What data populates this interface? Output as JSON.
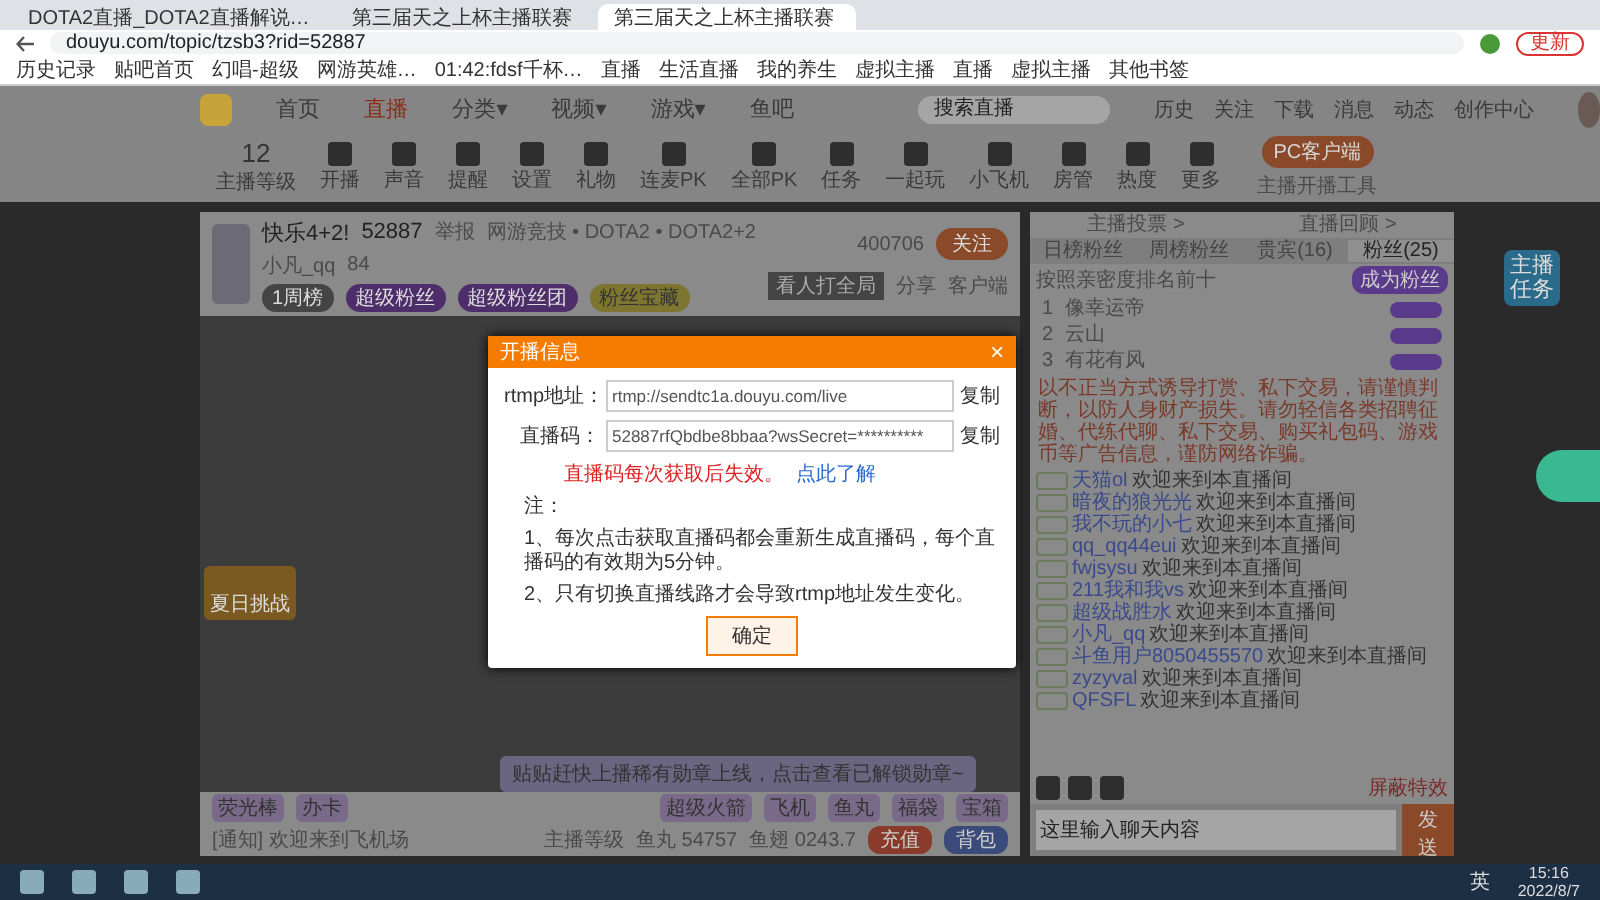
{
  "browser": {
    "tabs": [
      {
        "title": "DOTA2直播_DOTA2直播解说…",
        "selected": false
      },
      {
        "title": "第三届天之上杯主播联赛",
        "selected": false
      },
      {
        "title": "第三届天之上杯主播联赛",
        "selected": true
      }
    ],
    "address": "douyu.com/topic/tzsb3?rid=52887",
    "update_button": "更新",
    "bookmarks": [
      "历史记录",
      "贴吧首页",
      "幻唱-超级",
      "网游英雄…",
      "01:42:fdsf千杯…",
      "直播",
      "生活直播",
      "我的养生",
      "虚拟主播",
      "直播",
      "虚拟主播",
      "其他书签"
    ]
  },
  "nav": {
    "items": [
      {
        "label": "首页",
        "selected": false
      },
      {
        "label": "直播",
        "selected": true
      },
      {
        "label": "分类▾",
        "selected": false
      },
      {
        "label": "视频▾",
        "selected": false
      },
      {
        "label": "游戏▾",
        "selected": false
      },
      {
        "label": "鱼吧",
        "selected": false
      }
    ],
    "search": {
      "placeholder": "搜索直播"
    },
    "actions": [
      "历史",
      "关注",
      "下载",
      "消息",
      "动态",
      "创作中心"
    ]
  },
  "toolbar": {
    "level": "12",
    "level_label": "主播等级",
    "items": [
      "开播",
      "声音",
      "提醒",
      "设置",
      "礼物",
      "连麦PK",
      "全部PK",
      "任务",
      "一起玩",
      "小飞机",
      "房管",
      "热度",
      "更多"
    ],
    "pc_button": "PC客户端",
    "pc_caption": "主播开播工具"
  },
  "room": {
    "title": "快乐4+2!",
    "room_id": "52887",
    "report": "举报",
    "category": "网游竞技 • DOTA2 • DOTA2+2",
    "streamer": "小凡_qq",
    "heat": "84",
    "follow_count": "400706",
    "follow_button": "关注",
    "share": "分享",
    "client": "客户端",
    "rank_badge": "看人打全局",
    "tags": [
      "1周榜",
      "超级粉丝",
      "超级粉丝团",
      "粉丝宝藏"
    ],
    "side_badge": "夏日挑战"
  },
  "banner": "贴贴赶快上播稀有勋章上线，点击查看已解锁勋章~",
  "dialog": {
    "title": "开播信息",
    "close": "×",
    "fields": [
      {
        "label": "rtmp地址：",
        "value": "rtmp://sendtc1a.douyu.com/live",
        "copy": "复制"
      },
      {
        "label": "直播码：",
        "value": "52887rfQbdbe8bbaa?wsSecret=**********",
        "copy": "复制"
      }
    ],
    "warning": "直播码每次获取后失效。",
    "link": "点此了解",
    "notes": [
      "注：",
      "1、每次点击获取直播码都会重新生成直播码，每个直播码的有效期为5分钟。",
      "2、只有切换直播线路才会导致rtmp地址发生变化。"
    ],
    "ok": "确定"
  },
  "gifts": {
    "left": [
      "荧光棒",
      "办卡"
    ],
    "right": [
      "超级火箭",
      "飞机",
      "鱼丸",
      "福袋",
      "宝箱"
    ],
    "notice": "[通知] 欢迎来到飞机场",
    "anchor_level": "主播等级",
    "yuwan": "鱼丸 54757",
    "yuchi": "鱼翅 0243.7",
    "recharge": "充值",
    "bag": "背包"
  },
  "chat": {
    "links": [
      "主播投票 >",
      "直播回顾 >"
    ],
    "tabs": [
      {
        "label": "日榜粉丝",
        "selected": false
      },
      {
        "label": "周榜粉丝",
        "selected": false
      },
      {
        "label": "贵宾(16)",
        "selected": false
      },
      {
        "label": "粉丝(25)",
        "selected": true
      }
    ],
    "rank_title": "按照亲密度排名前十",
    "join_button": "成为粉丝",
    "ranks": [
      {
        "no": "1",
        "name": "像幸运帝"
      },
      {
        "no": "2",
        "name": "云山"
      },
      {
        "no": "3",
        "name": "有花有风"
      }
    ],
    "notice": "以不正当方式诱导打赏、私下交易，请谨慎判断，以防人身财产损失。请勿轻信各类招聘征婚、代练代聊、私下交易、购买礼包码、游戏币等广告信息，谨防网络诈骗。",
    "messages": [
      {
        "user": "天猫ol",
        "text": "欢迎来到本直播间"
      },
      {
        "user": "暗夜的狼光光",
        "text": "欢迎来到本直播间"
      },
      {
        "user": "我不玩的小七",
        "text": "欢迎来到本直播间"
      },
      {
        "user": "qq_qq44eui",
        "text": "欢迎来到本直播间"
      },
      {
        "user": "fwjsysu",
        "text": "欢迎来到本直播间"
      },
      {
        "user": "211我和我vs",
        "text": "欢迎来到本直播间"
      },
      {
        "user": "超级战胜水",
        "text": "欢迎来到本直播间"
      },
      {
        "user": "小凡_qq",
        "text": "欢迎来到本直播间"
      },
      {
        "user": "斗鱼用户8050455570",
        "text": "欢迎来到本直播间"
      },
      {
        "user": "zyzyval",
        "text": "欢迎来到本直播间"
      },
      {
        "user": "QFSFL",
        "text": "欢迎来到本直播间"
      }
    ],
    "block_button": "屏蔽特效",
    "input": {
      "placeholder": "这里输入聊天内容"
    },
    "send": "发送"
  },
  "task_sticker": "主播任务",
  "taskbar": {
    "ime": "英",
    "time": "15:16",
    "date": "2022/8/7"
  }
}
